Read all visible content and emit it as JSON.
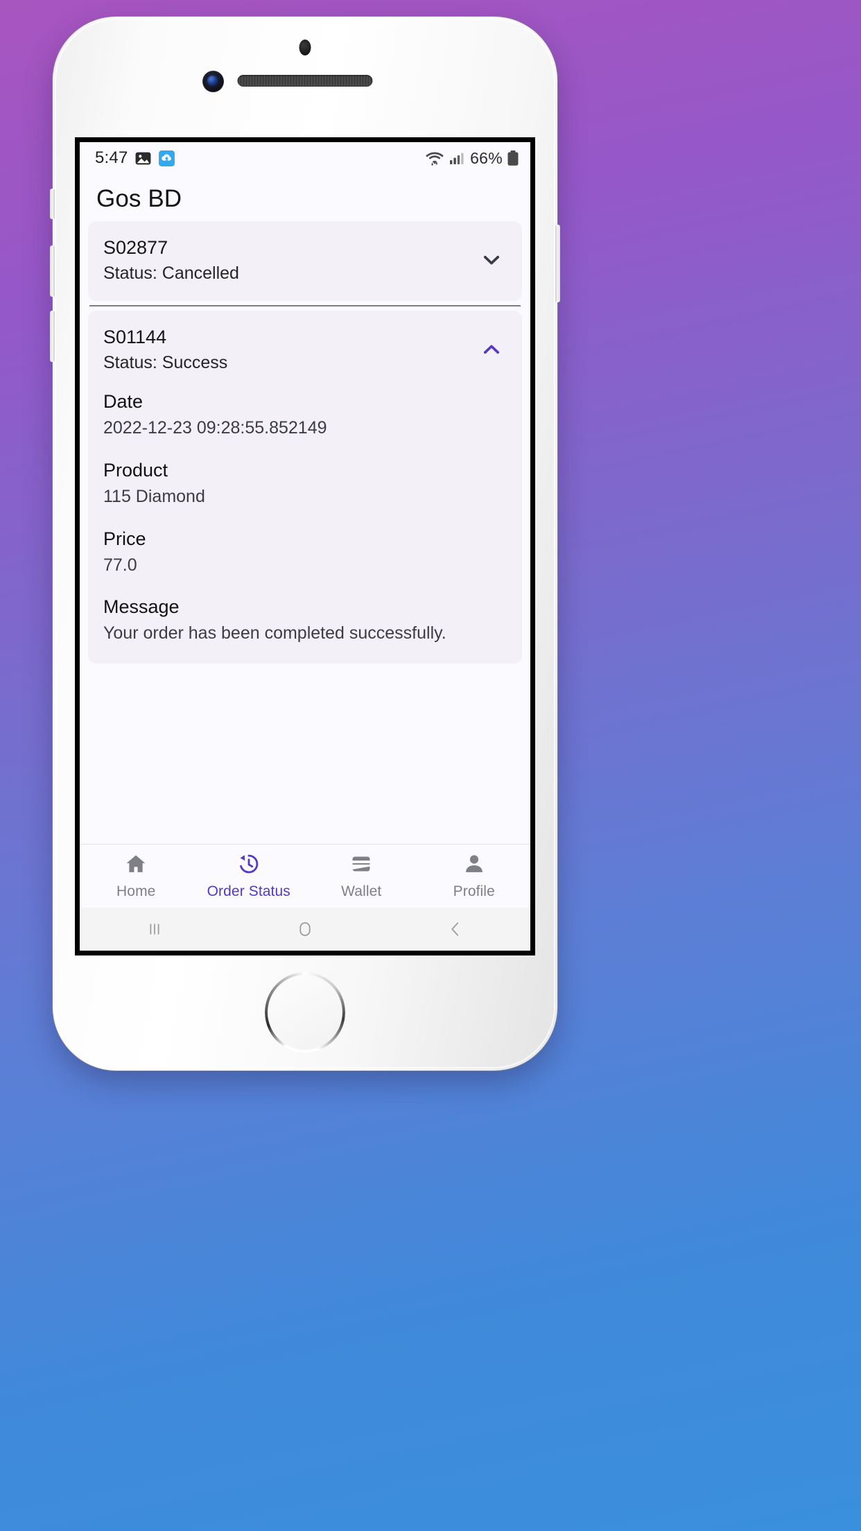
{
  "device": {
    "frame": "white-iphone-style-mockup",
    "background_gradient": [
      "#A855C0",
      "#3A90DD"
    ]
  },
  "status_bar": {
    "time": "5:47",
    "left_icons": [
      "image-icon",
      "cloud-upload-icon"
    ],
    "right_icons": [
      "wifi-icon",
      "cellular-signal-icon"
    ],
    "battery_percent": "66%",
    "battery_icon": "battery-icon"
  },
  "app_bar": {
    "title": "Gos BD"
  },
  "orders": [
    {
      "id": "S02877",
      "status_line": "Status: Cancelled",
      "status_value": "Cancelled",
      "expanded": false,
      "chevron": "chevron-down-icon",
      "chevron_color": "#3a3a44"
    },
    {
      "id": "S01144",
      "status_line": "Status: Success",
      "status_value": "Success",
      "expanded": true,
      "chevron": "chevron-up-icon",
      "chevron_color": "#5639c4",
      "details": [
        {
          "label": "Date",
          "value": "2022-12-23 09:28:55.852149"
        },
        {
          "label": "Product",
          "value": "115 Diamond"
        },
        {
          "label": "Price",
          "value": "77.0"
        },
        {
          "label": "Message",
          "value": "Your order has been completed successfully."
        }
      ]
    }
  ],
  "bottom_nav": {
    "active_index": 1,
    "active_color": "#5639c4",
    "inactive_color": "#7f7f86",
    "items": [
      {
        "label": "Home",
        "icon": "home-icon"
      },
      {
        "label": "Order Status",
        "icon": "history-clock-icon"
      },
      {
        "label": "Wallet",
        "icon": "wallet-icon"
      },
      {
        "label": "Profile",
        "icon": "person-icon"
      }
    ]
  },
  "system_nav": {
    "buttons": [
      {
        "icon": "recents-icon"
      },
      {
        "icon": "home-circle-icon"
      },
      {
        "icon": "back-chevron-icon"
      }
    ]
  }
}
